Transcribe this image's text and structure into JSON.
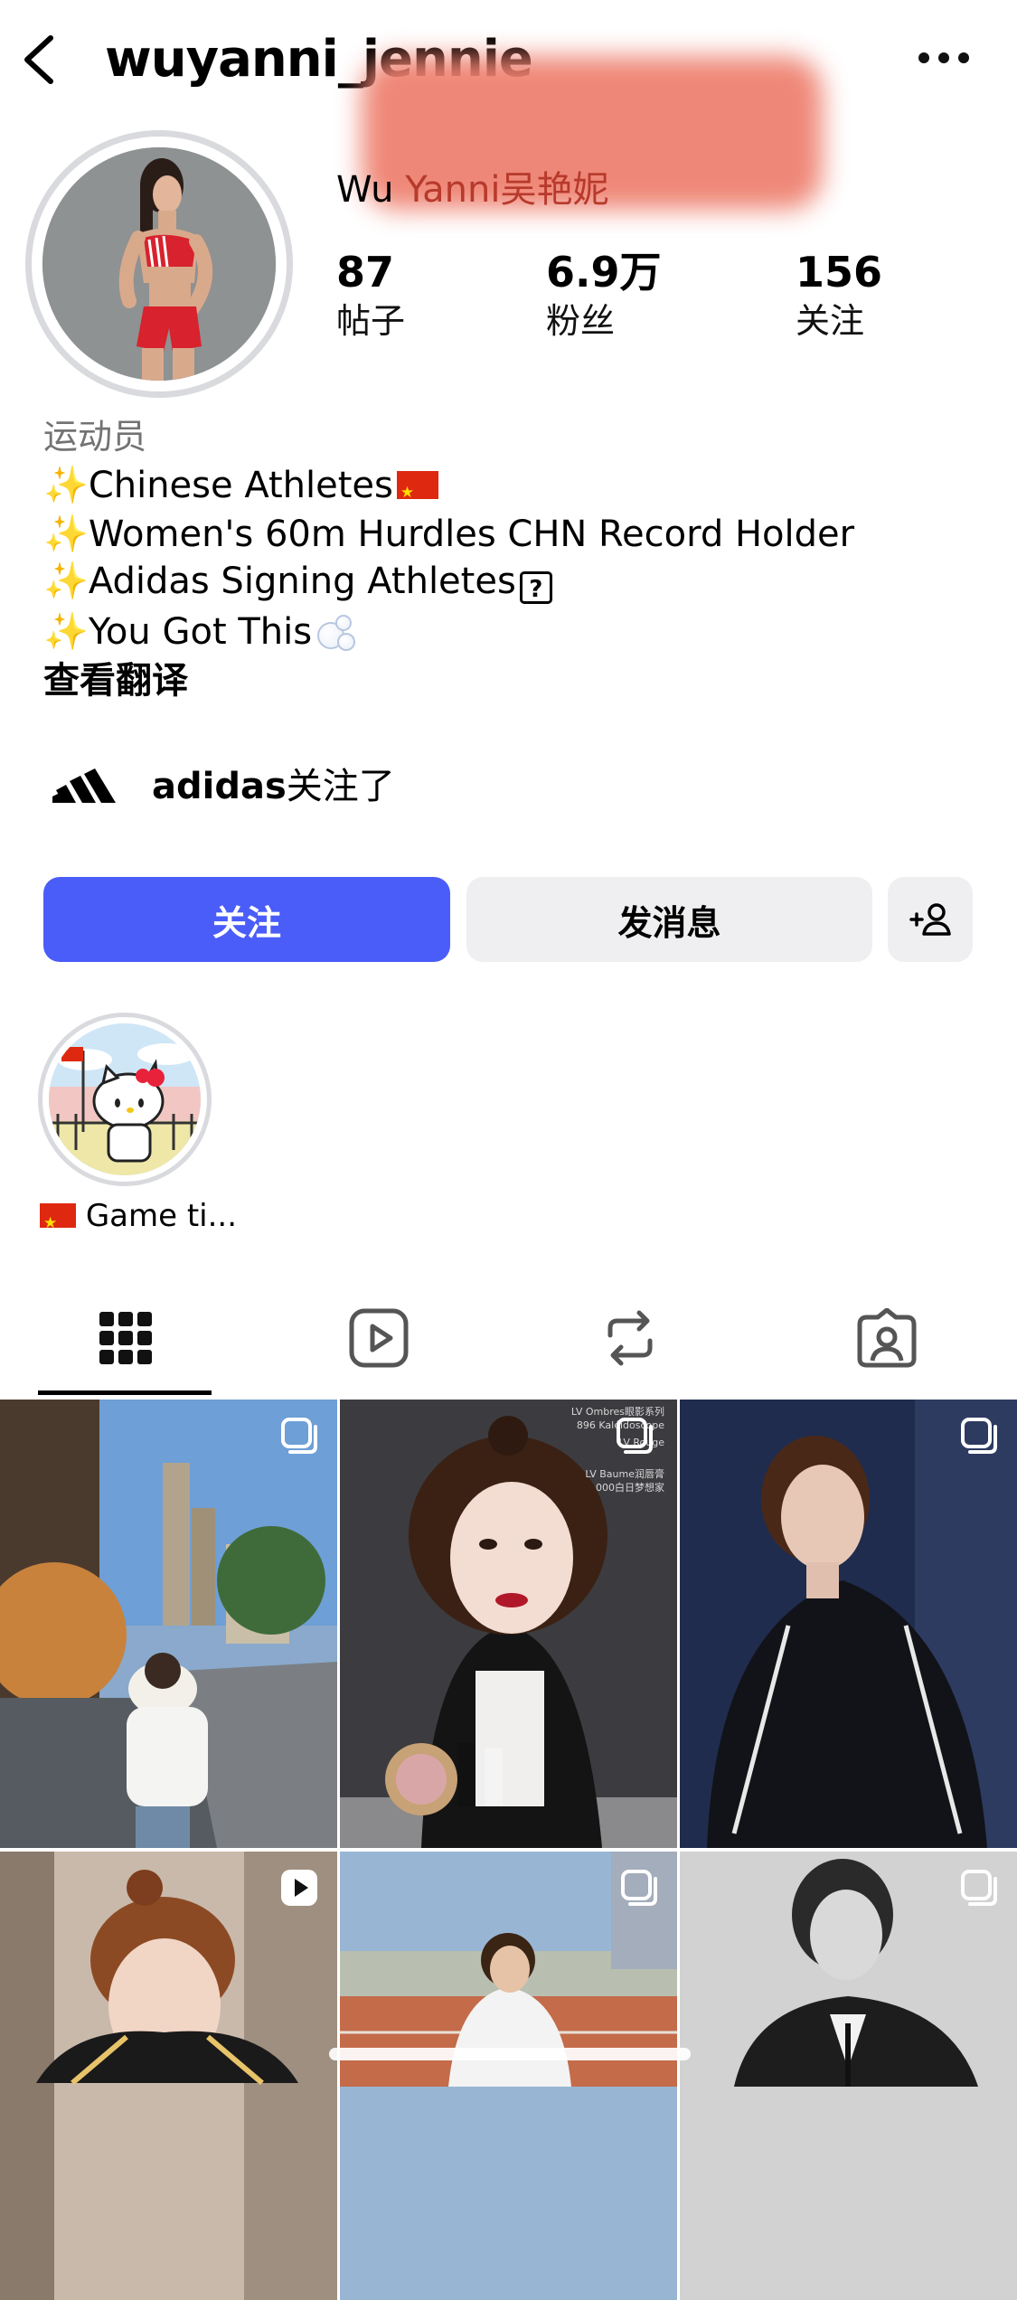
{
  "header": {
    "username": "wuyanni_jennie"
  },
  "profile": {
    "display_name_prefix": "Wu ",
    "display_name_rest": "Yanni吴艳妮",
    "stats": [
      {
        "value": "87",
        "label": "帖子"
      },
      {
        "value": "6.9万",
        "label": "粉丝"
      },
      {
        "value": "156",
        "label": "关注"
      }
    ],
    "category": "运动员",
    "bio": {
      "line1": "Chinese Athletes",
      "line2": "Women's 60m Hurdles CHN Record Holder",
      "line3": "Adidas Signing Athletes",
      "line4": "You Got This"
    },
    "see_translation": "查看翻译",
    "followed_by": {
      "account": "adidas",
      "suffix": "关注了"
    }
  },
  "actions": {
    "follow_label": "关注",
    "message_label": "发消息"
  },
  "highlights": [
    {
      "label": "Game ti..."
    }
  ],
  "tabs": [
    {
      "icon": "grid-icon",
      "active": true
    },
    {
      "icon": "reels-icon",
      "active": false
    },
    {
      "icon": "reposts-icon",
      "active": false
    },
    {
      "icon": "tagged-icon",
      "active": false
    }
  ],
  "grid": {
    "posts": [
      {
        "type": "carousel"
      },
      {
        "type": "carousel",
        "overlay_text": [
          "LV Ombres眼影系列",
          "896 Kaléidoscope",
          "LV Rouge",
          "LV Baume润唇膏",
          "000白日梦想家"
        ]
      },
      {
        "type": "carousel"
      },
      {
        "type": "reel"
      },
      {
        "type": "carousel"
      },
      {
        "type": "carousel"
      }
    ]
  },
  "colors": {
    "follow_button": "#4a5df9",
    "secondary_button": "#efeff1",
    "name_accent": "#b73a2c",
    "flag_red": "#de2910"
  }
}
